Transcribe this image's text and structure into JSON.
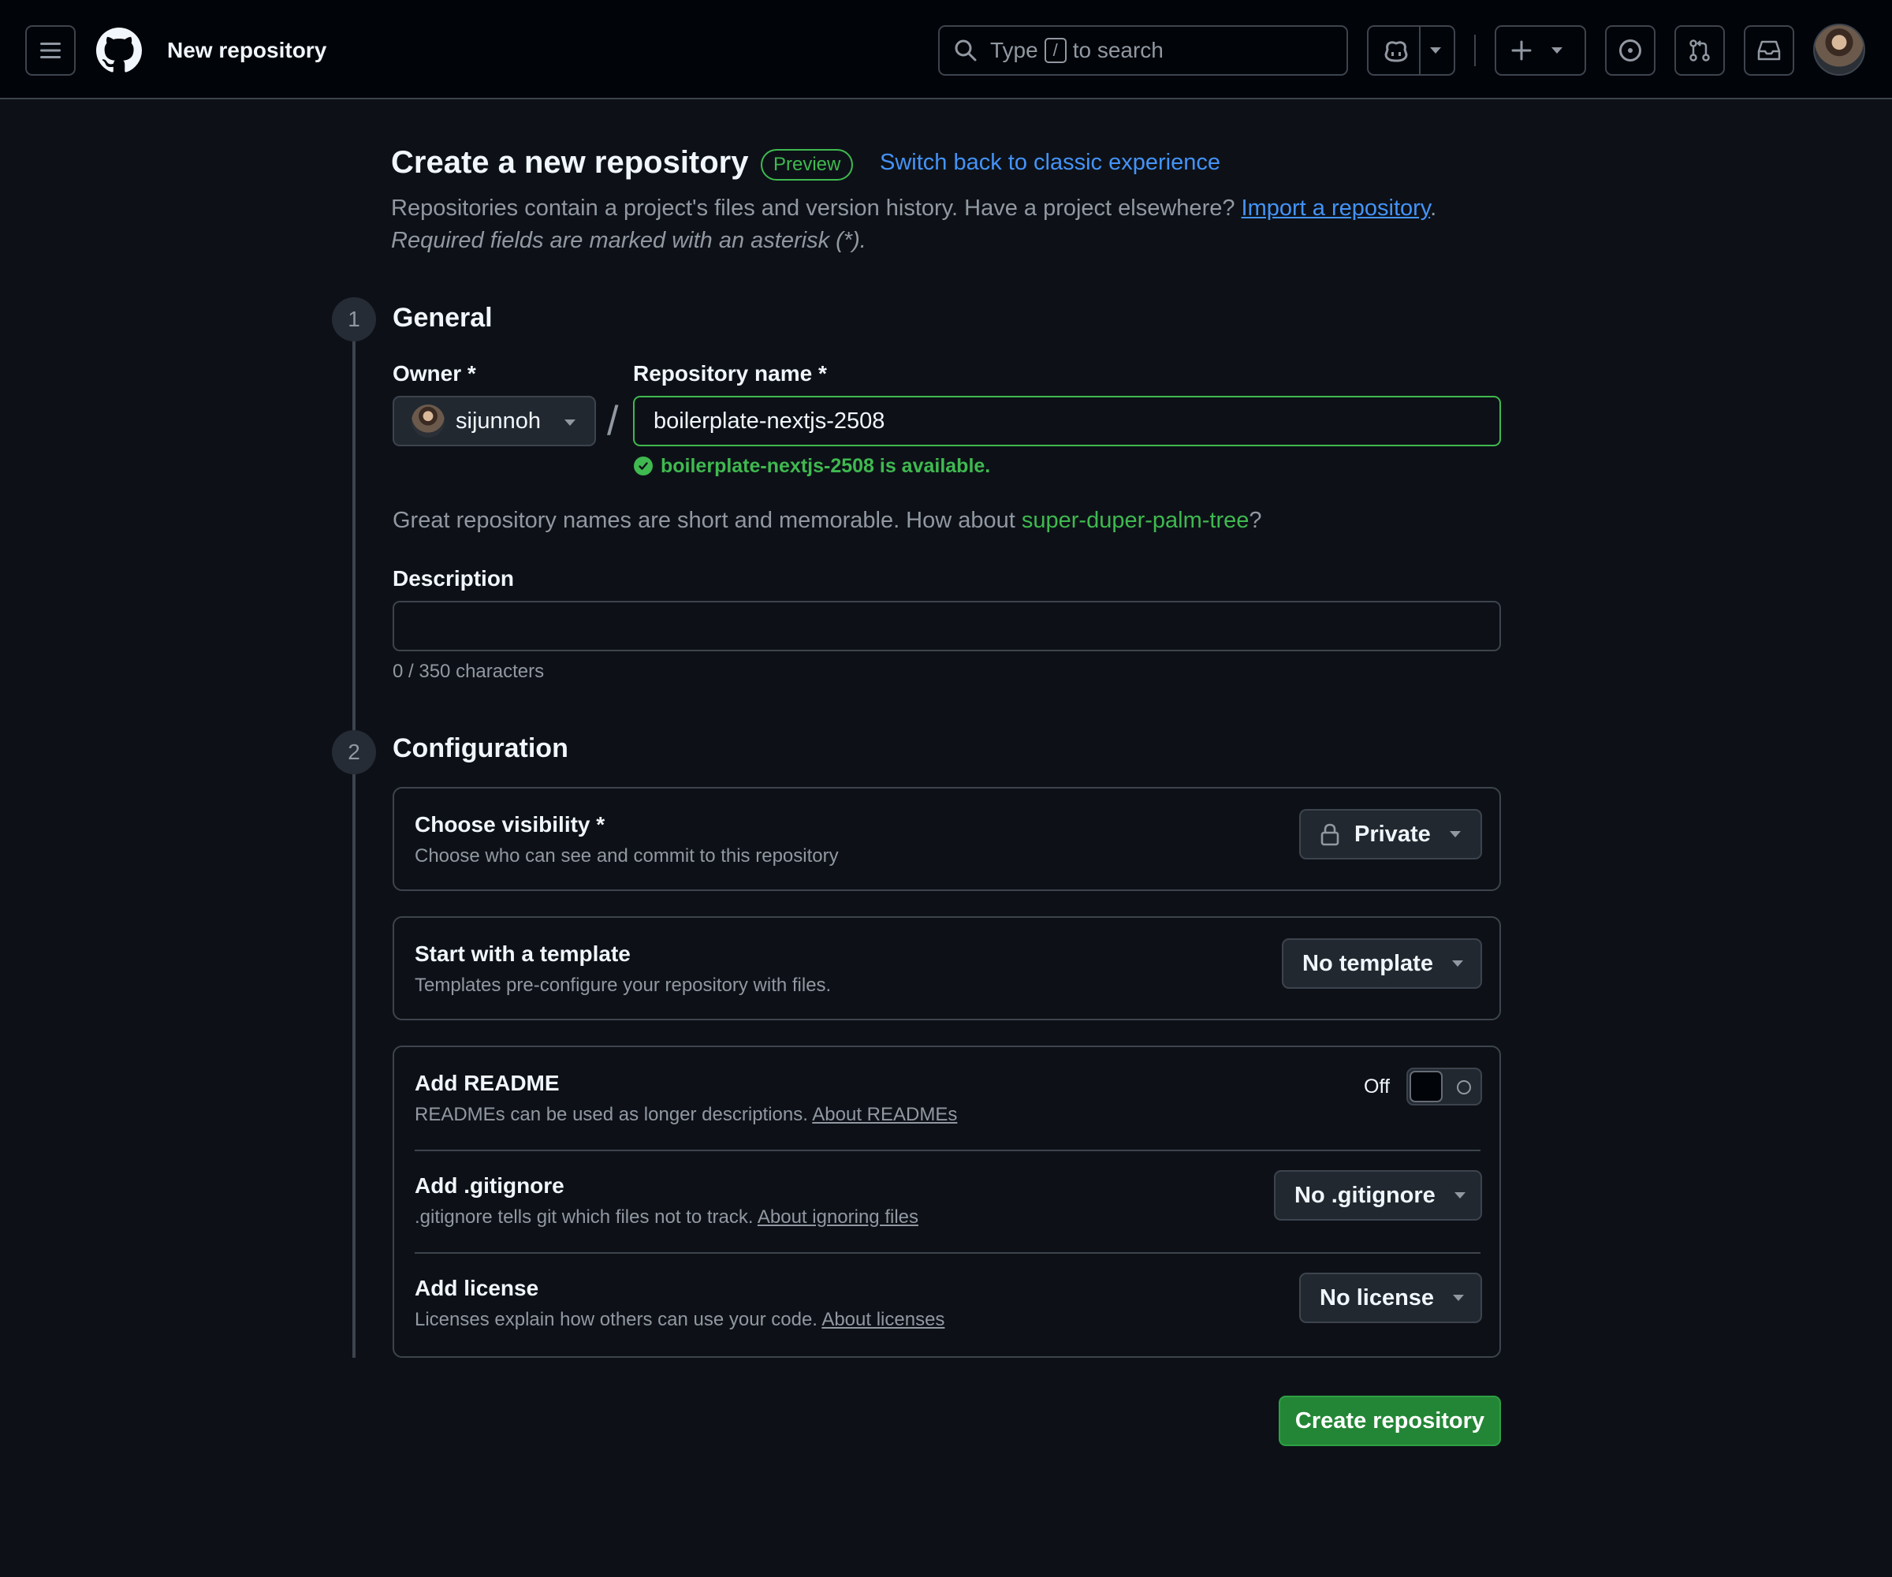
{
  "header": {
    "title": "New repository",
    "search": {
      "prefix": "Type",
      "key": "/",
      "suffix": "to search"
    }
  },
  "page": {
    "title": "Create a new repository",
    "badge": "Preview",
    "switch_link": "Switch back to classic experience",
    "intro_text": "Repositories contain a project's files and version history. Have a project elsewhere?",
    "import_link": "Import a repository",
    "intro_end": ".",
    "required_note": "Required fields are marked with an asterisk (*)."
  },
  "general": {
    "step": "1",
    "title": "General",
    "owner_label": "Owner *",
    "owner_value": "sijunnoh",
    "separator": "/",
    "repo_label": "Repository name *",
    "repo_value": "boilerplate-nextjs-2508",
    "available": "boilerplate-nextjs-2508 is available.",
    "suggest_prefix": "Great repository names are short and memorable. How about",
    "suggest_name": "super-duper-palm-tree",
    "suggest_suffix": "?",
    "description_label": "Description",
    "description_value": "",
    "char_count": "0 / 350 characters"
  },
  "configuration": {
    "step": "2",
    "title": "Configuration",
    "visibility": {
      "title": "Choose visibility *",
      "desc": "Choose who can see and commit to this repository",
      "value": "Private"
    },
    "template": {
      "title": "Start with a template",
      "desc": "Templates pre-configure your repository with files.",
      "value": "No template"
    },
    "readme": {
      "title": "Add README",
      "desc": "READMEs can be used as longer descriptions.",
      "link": "About READMEs",
      "toggle_label": "Off"
    },
    "gitignore": {
      "title": "Add .gitignore",
      "desc": ".gitignore tells git which files not to track.",
      "link": "About ignoring files",
      "value": "No .gitignore"
    },
    "license": {
      "title": "Add license",
      "desc": "Licenses explain how others can use your code.",
      "link": "About licenses",
      "value": "No license"
    }
  },
  "actions": {
    "create": "Create repository"
  },
  "colors": {
    "background": "#0d1117",
    "header_bg": "#010409",
    "accent_blue": "#4493f8",
    "success_green": "#3fb950",
    "primary_button": "#238636"
  }
}
